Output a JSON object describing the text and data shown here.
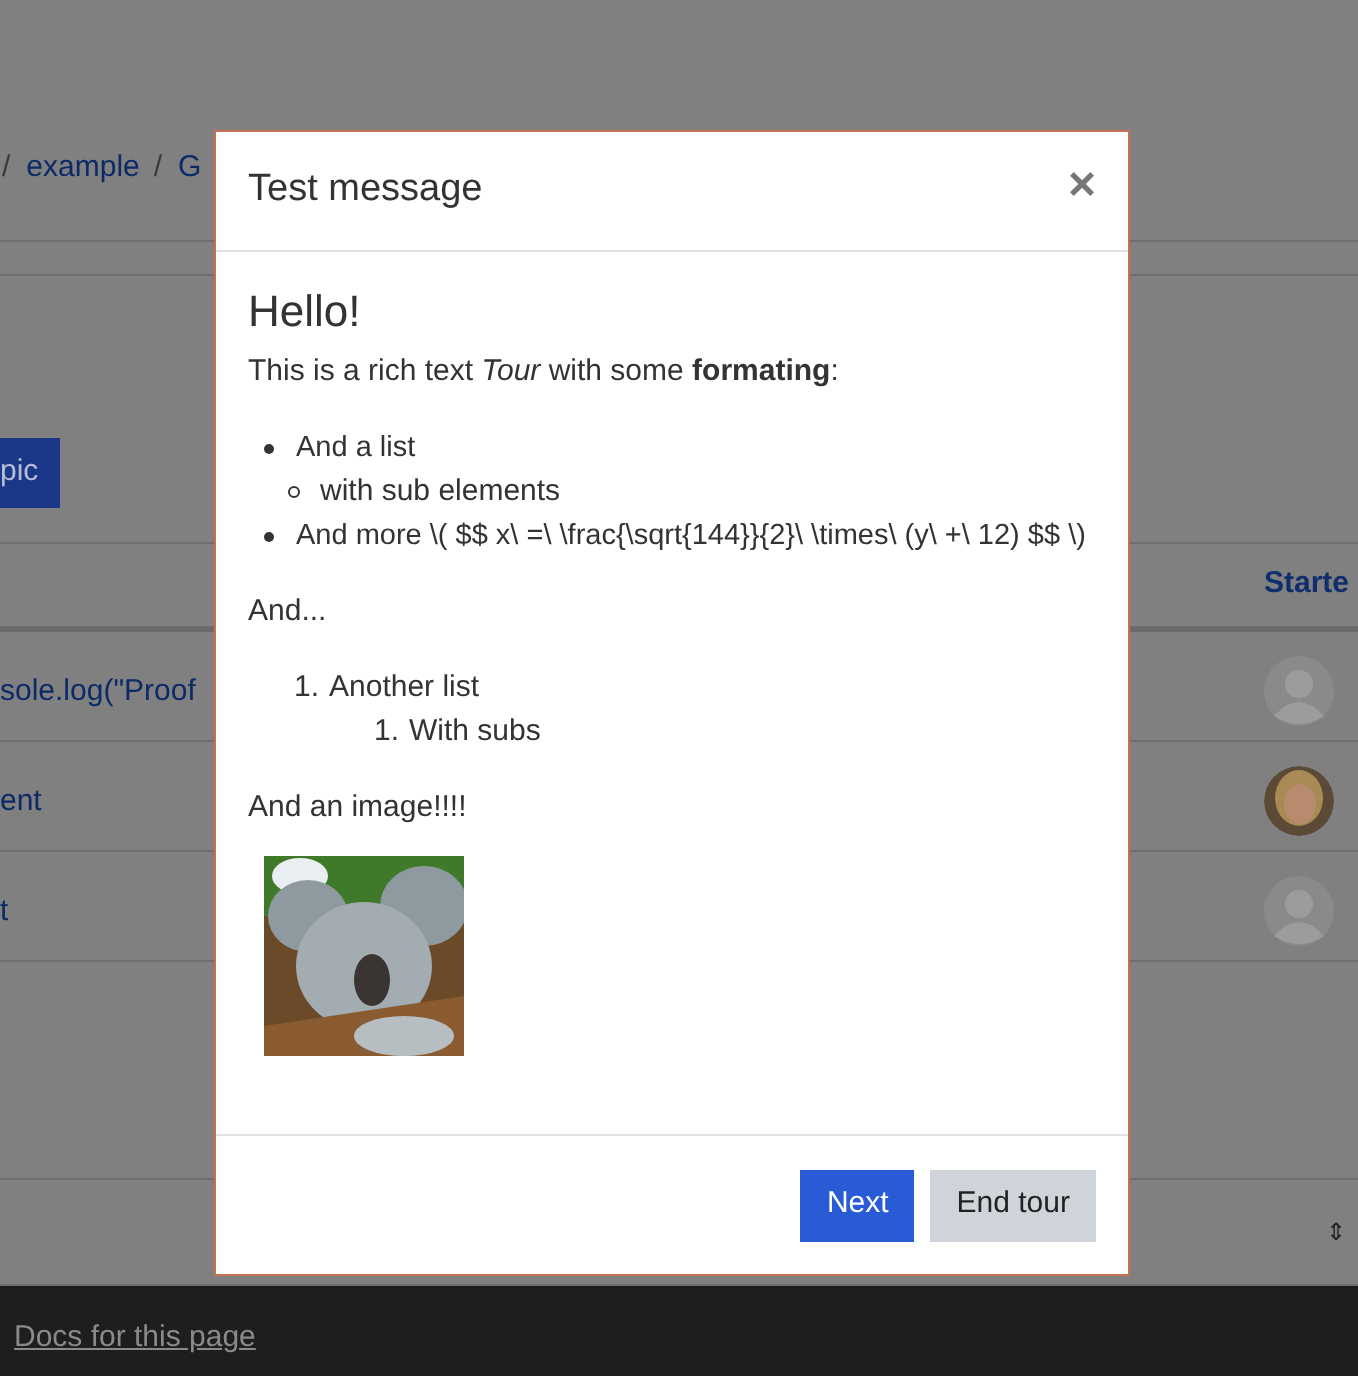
{
  "background": {
    "breadcrumb": [
      {
        "kind": "separator",
        "text": "/"
      },
      {
        "kind": "link",
        "text": "example"
      },
      {
        "kind": "separator",
        "text": "/"
      },
      {
        "kind": "link",
        "text": "G"
      }
    ],
    "button": "pic",
    "column_header": "Starte",
    "rows": [
      {
        "link": "sole.log(\"Proof",
        "kind": "default"
      },
      {
        "link": "ent"
      },
      {
        "link": "t",
        "kind": "default"
      }
    ],
    "sort_icon": "⇕",
    "footer_link": "Docs for this page"
  },
  "modal": {
    "title": "Test message",
    "close": "×",
    "heading": "Hello!",
    "intro": "This is a rich text *Tour* with some **formating**:",
    "bullets": [
      {
        "text": "And a list",
        "children": [
          {
            "text": "with sub elements"
          }
        ]
      },
      {
        "text": "And more \\( $$ x\\ =\\ \\frac{\\sqrt{144}}{2}\\ \\times\\ (y\\ +\\ 12) $$ \\)"
      }
    ],
    "paragraph": "And...",
    "ordered": [
      {
        "number": "1.",
        "text": "Another list",
        "children": [
          {
            "number": "1.",
            "text": "With subs"
          }
        ]
      }
    ],
    "image_caption": "And an image!!!!",
    "buttons": [
      {
        "label": "Next",
        "kind": "primary"
      },
      {
        "label": "End tour",
        "kind": "secondary"
      }
    ]
  }
}
